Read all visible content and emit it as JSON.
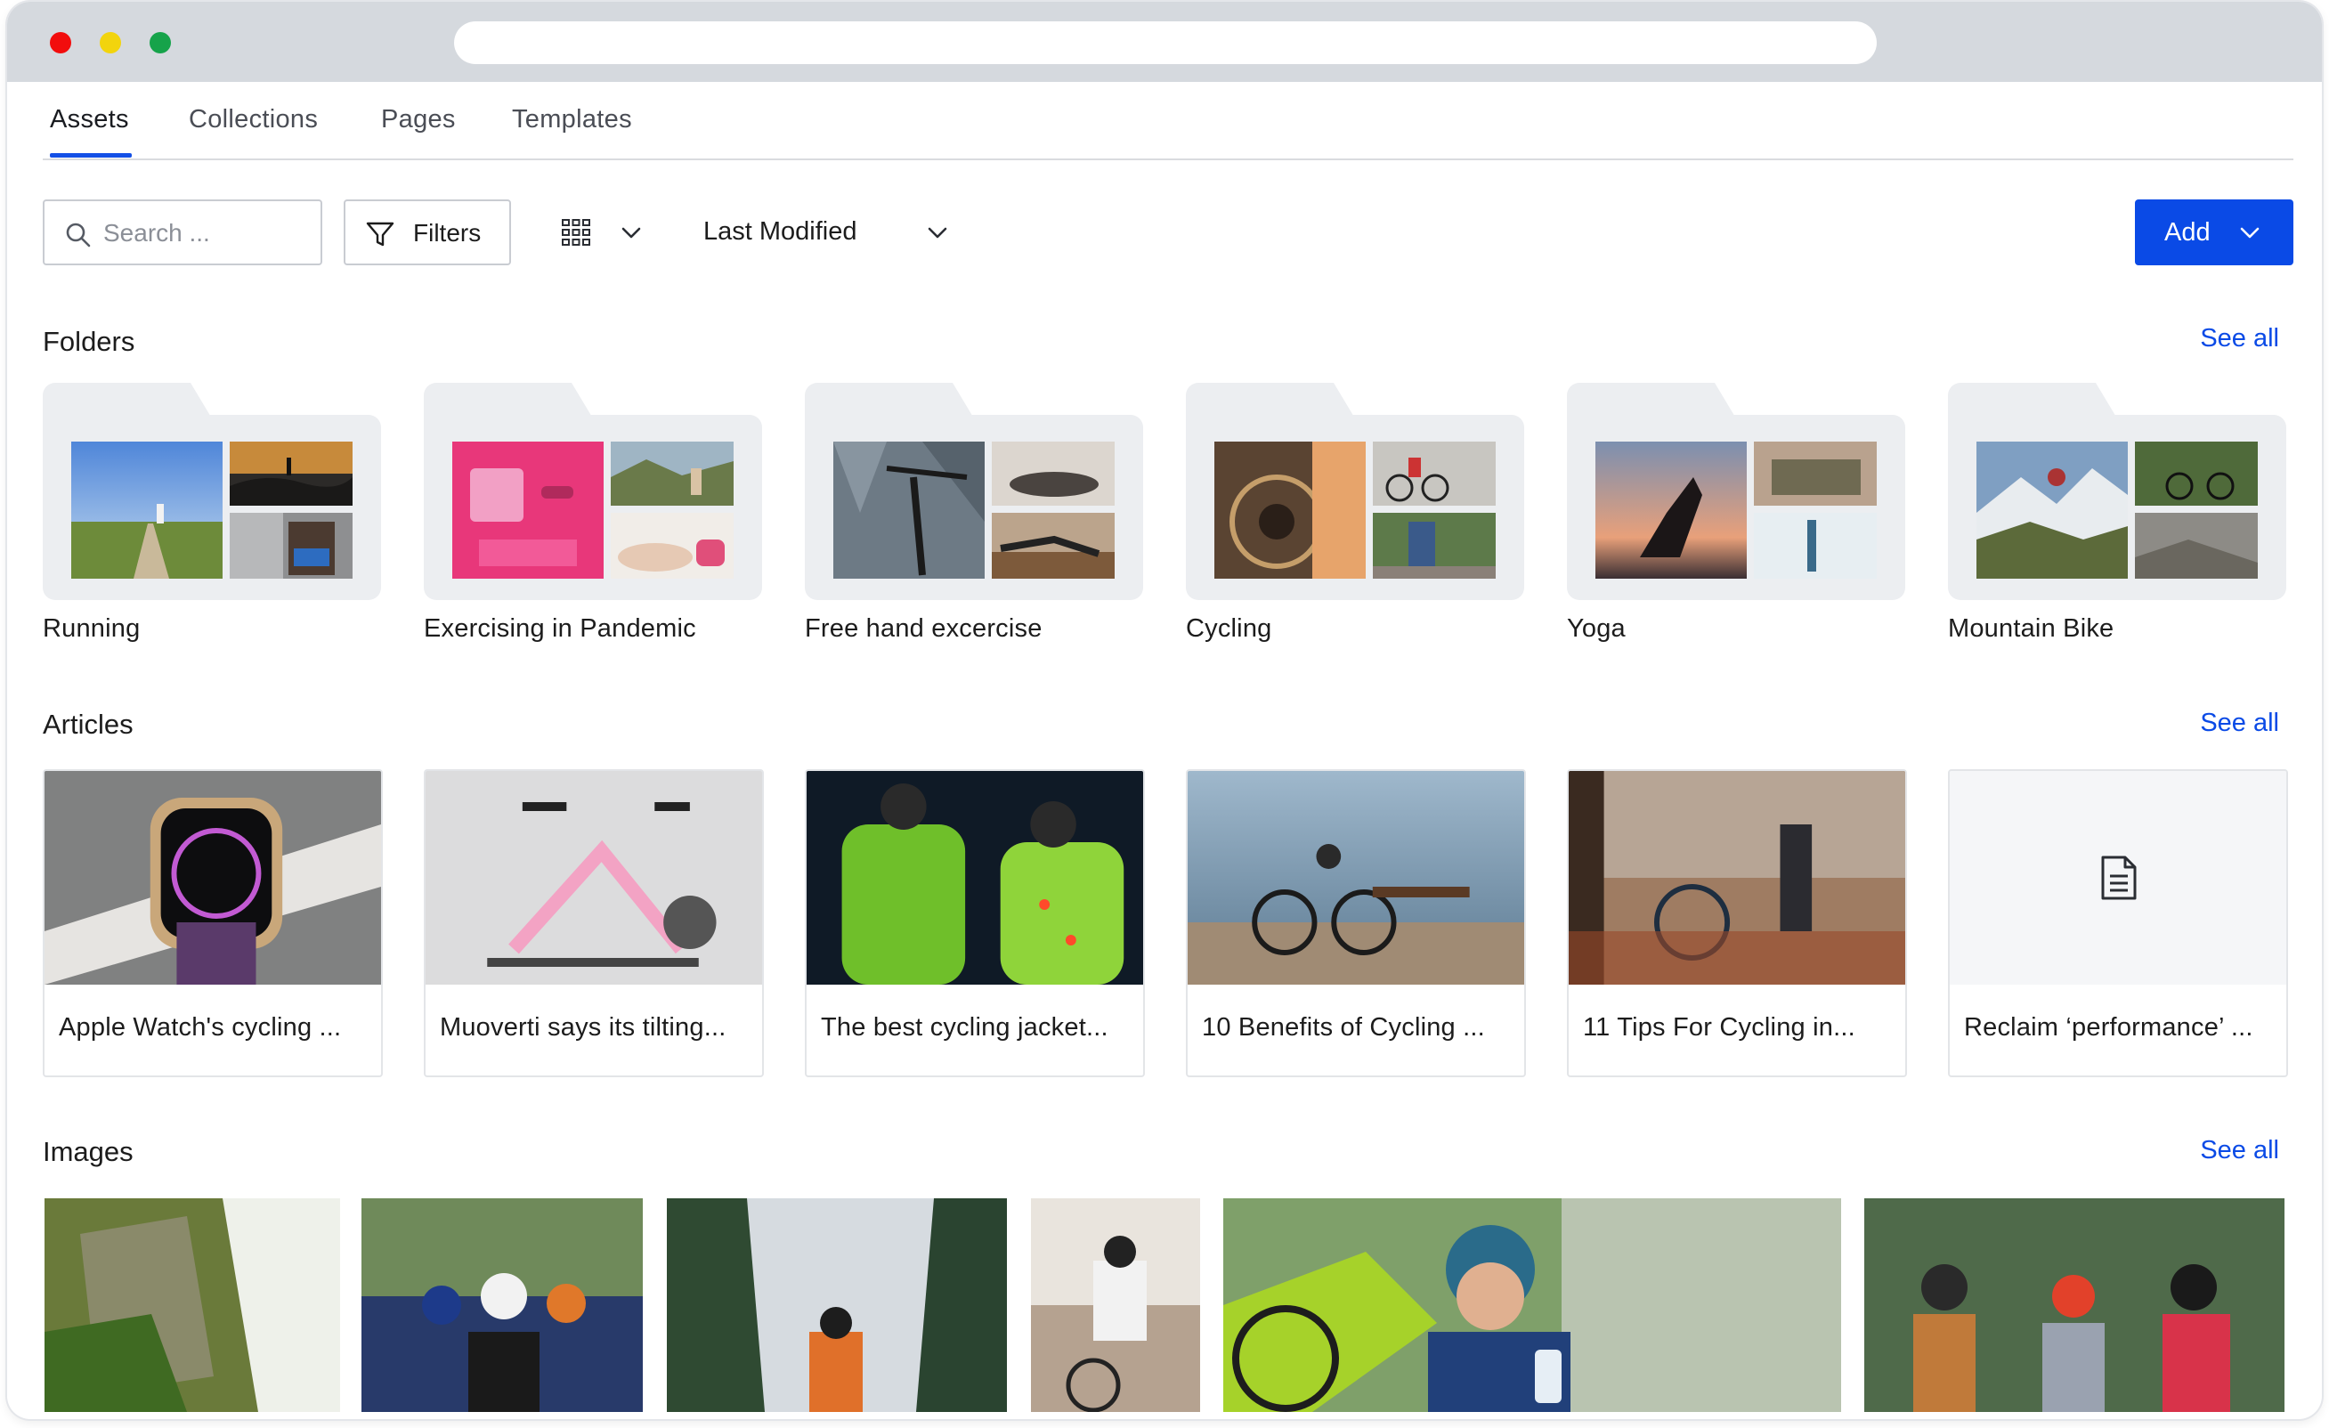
{
  "tabs": [
    {
      "label": "Assets",
      "active": true
    },
    {
      "label": "Collections",
      "active": false
    },
    {
      "label": "Pages",
      "active": false
    },
    {
      "label": "Templates",
      "active": false
    }
  ],
  "toolbar": {
    "search_placeholder": "Search ...",
    "filters_label": "Filters",
    "view_icon": "grid-view-icon",
    "sort_label": "Last Modified",
    "add_label": "Add"
  },
  "colors": {
    "accent": "#0a4ae6",
    "folder_bg": "#eceef1",
    "traffic_red": "#f20d0d",
    "traffic_yellow": "#f2d40d",
    "traffic_green": "#16a34a"
  },
  "sections": {
    "folders": {
      "title": "Folders",
      "see_all": "See all"
    },
    "articles": {
      "title": "Articles",
      "see_all": "See all"
    },
    "images": {
      "title": "Images",
      "see_all": "See all"
    }
  },
  "folders": [
    {
      "label": "Running"
    },
    {
      "label": "Exercising in Pandemic"
    },
    {
      "label": "Free hand excercise"
    },
    {
      "label": "Cycling"
    },
    {
      "label": "Yoga"
    },
    {
      "label": "Mountain Bike"
    }
  ],
  "articles": [
    {
      "title": "Apple Watch's cycling ..."
    },
    {
      "title": "Muoverti says its tilting..."
    },
    {
      "title": "The best cycling jacket..."
    },
    {
      "title": "10 Benefits of Cycling ..."
    },
    {
      "title": "11 Tips For Cycling in..."
    },
    {
      "title": "Reclaim ‘performance’ ..."
    }
  ]
}
